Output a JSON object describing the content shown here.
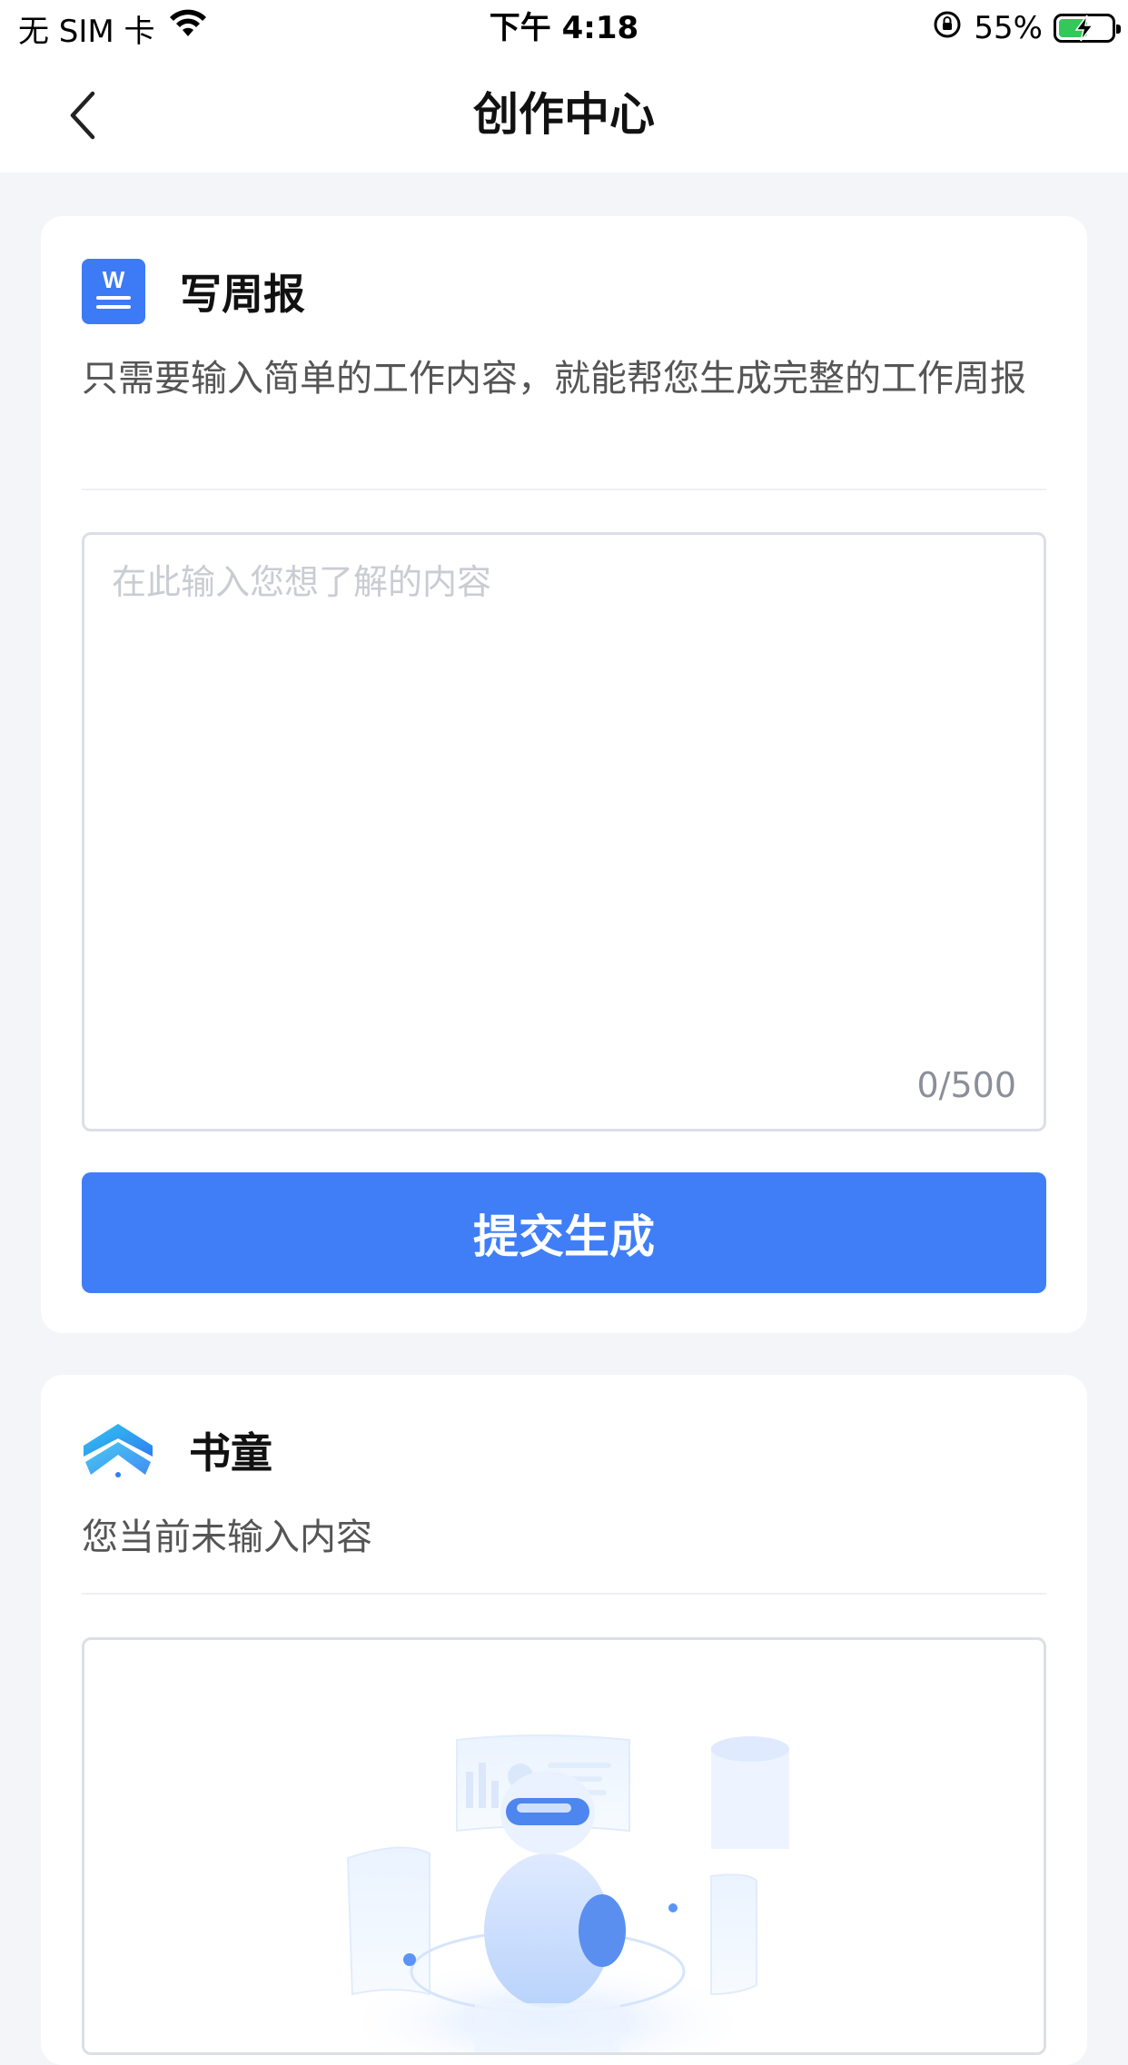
{
  "status_bar": {
    "carrier": "无 SIM 卡",
    "time": "下午 4:18",
    "battery_percent": "55%",
    "battery_level": 0.55,
    "icons": [
      "wifi-icon",
      "rotation-lock-icon",
      "battery-charging-icon"
    ]
  },
  "nav": {
    "title": "创作中心",
    "back_icon": "chevron-left-icon"
  },
  "weekly_report": {
    "icon": "word-document-icon",
    "icon_color": "#3d7af6",
    "title": "写周报",
    "description": "只需要输入简单的工作内容，就能帮您生成完整的工作周报",
    "input": {
      "placeholder": "在此输入您想了解的内容",
      "value": "",
      "counter": "0/500"
    },
    "submit_label": "提交生成",
    "submit_color": "#3f7ef7"
  },
  "shutong": {
    "icon": "shutong-logo-icon",
    "title": "书童",
    "status_text": "您当前未输入内容",
    "illustration": "robot-illustration"
  }
}
